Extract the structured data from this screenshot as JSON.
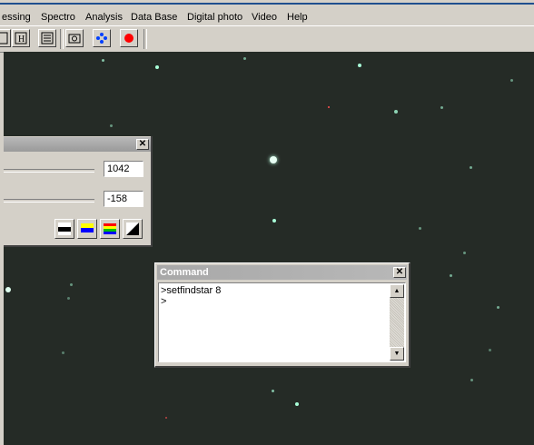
{
  "menu": {
    "items": [
      "essing",
      "Spectro",
      "Analysis",
      "Data Base",
      "Digital photo",
      "Video",
      "Help"
    ]
  },
  "toolbar": {
    "buttons": [
      {
        "icon": "image-icon"
      },
      {
        "icon": "histogram-icon"
      },
      {
        "icon": "list-icon"
      },
      {
        "icon": "camera-icon"
      },
      {
        "icon": "crosshair-icon"
      },
      {
        "icon": "record-icon"
      }
    ]
  },
  "visu_panel": {
    "high_value": "1042",
    "low_value": "-158",
    "palette_buttons": [
      {
        "icon": "palette-gray-icon"
      },
      {
        "icon": "palette-blue-yellow-icon"
      },
      {
        "icon": "palette-rainbow-icon"
      },
      {
        "icon": "palette-invert-icon"
      }
    ]
  },
  "command_window": {
    "title": "Command",
    "lines": [
      ">setfindstar 8",
      ">"
    ]
  },
  "colors": {
    "sky_background": "#252b26",
    "star": "#a8ffd8",
    "window_face": "#d4d0c8"
  }
}
